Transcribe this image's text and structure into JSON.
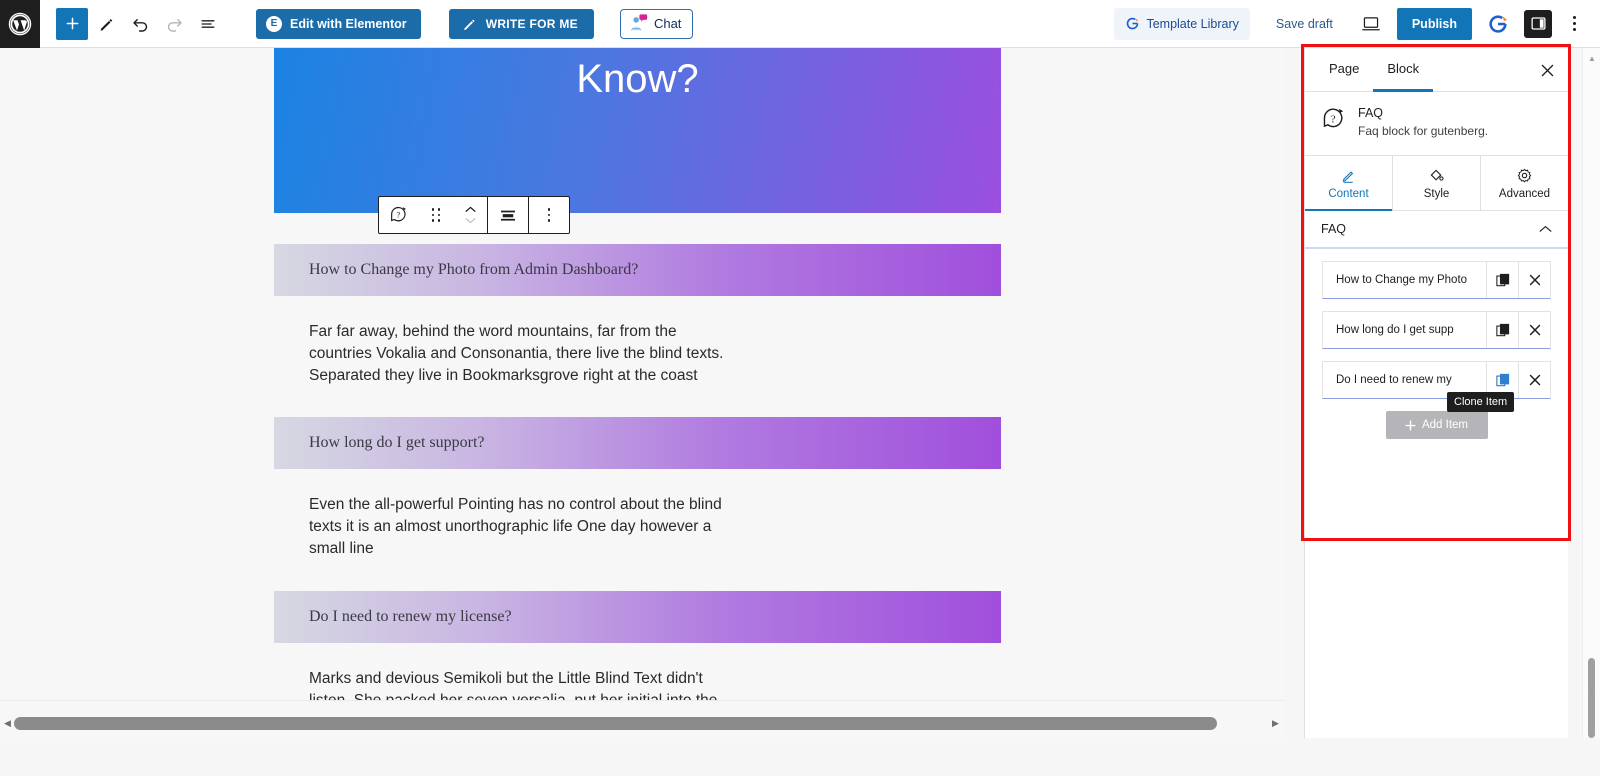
{
  "topbar": {
    "logo_icon": "wordpress-logo-icon",
    "add_block_label": "+",
    "tools": [
      {
        "name": "add-block-button",
        "icon": "plus-icon"
      },
      {
        "name": "edit-tool-button",
        "icon": "pencil-icon"
      },
      {
        "name": "undo-button",
        "icon": "undo-arrow-icon"
      },
      {
        "name": "redo-button",
        "icon": "redo-arrow-icon"
      },
      {
        "name": "document-overview-button",
        "icon": "list-view-icon"
      }
    ],
    "elementor_label": "Edit with Elementor",
    "elementor_badge": "E",
    "write_for_me_label": "WRITE FOR ME",
    "chat_label": "Chat",
    "template_library_label": "Template Library",
    "save_draft_label": "Save draft",
    "publish_label": "Publish",
    "view_icon": "preview-device-icon",
    "sidebar_toggle_icon": "settings-panel-icon",
    "more_icon": "more-options-icon",
    "accent_blue": "#1275b8",
    "elementor_blue": "#1b6ca8"
  },
  "block_toolbar": {
    "block_icon": "faq-block-icon",
    "drag_icon": "drag-handle-icon",
    "move_up_icon": "chevron-up-icon",
    "move_down_icon": "chevron-down-icon",
    "align_icon": "align-center-icon",
    "options_icon": "more-options-icon"
  },
  "content": {
    "hero_title": "FAQ's: What Will You Need To Know?",
    "hero_gradient_from": "#1b83e2",
    "hero_gradient_to": "#9b4fe0",
    "qa": [
      {
        "question": "How to Change my Photo from Admin Dashboard?",
        "answer": "Far far away, behind the word mountains, far from the countries Vokalia and Consonantia, there live the blind texts. Separated they live in Bookmarksgrove right at the coast"
      },
      {
        "question": "How long do I get support?",
        "answer": "Even the all-powerful Pointing has no control about the blind texts it is an almost unorthographic life One day however a small line"
      },
      {
        "question": "Do I need to renew my license?",
        "answer": "Marks and devious Semikoli but the Little Blind Text didn't listen. She packed her seven versalia, put her initial into the belt and made herself on the way."
      }
    ]
  },
  "sidebar": {
    "tabs": [
      {
        "label": "Page",
        "active": false
      },
      {
        "label": "Block",
        "active": true
      }
    ],
    "close_icon": "close-icon",
    "block": {
      "icon": "faq-block-icon",
      "title": "FAQ",
      "description": "Faq block for gutenberg."
    },
    "subtabs": [
      {
        "label": "Content",
        "icon": "pencil-icon",
        "active": true
      },
      {
        "label": "Style",
        "icon": "paint-bucket-icon",
        "active": false
      },
      {
        "label": "Advanced",
        "icon": "gear-icon",
        "active": false
      }
    ],
    "section": {
      "label": "FAQ",
      "collapse_icon": "chevron-up-icon"
    },
    "items": [
      {
        "label": "How to Change my Photo",
        "clone_icon": "clone-icon",
        "delete_icon": "close-icon",
        "clone_hover": false
      },
      {
        "label": "How long do I get supp",
        "clone_icon": "clone-icon",
        "delete_icon": "close-icon",
        "clone_hover": false
      },
      {
        "label": "Do I need to renew my",
        "clone_icon": "clone-icon",
        "delete_icon": "close-icon",
        "clone_hover": true
      }
    ],
    "add_item_label": "Add Item",
    "add_item_icon": "plus-icon",
    "tooltip": "Clone Item",
    "highlight_color": "#ee1111"
  },
  "scrollbars": {
    "vertical_up_icon": "triangle-up-icon",
    "vertical_down_icon": "triangle-down-icon",
    "horizontal_left_icon": "triangle-left-icon",
    "horizontal_right_icon": "triangle-right-icon"
  }
}
